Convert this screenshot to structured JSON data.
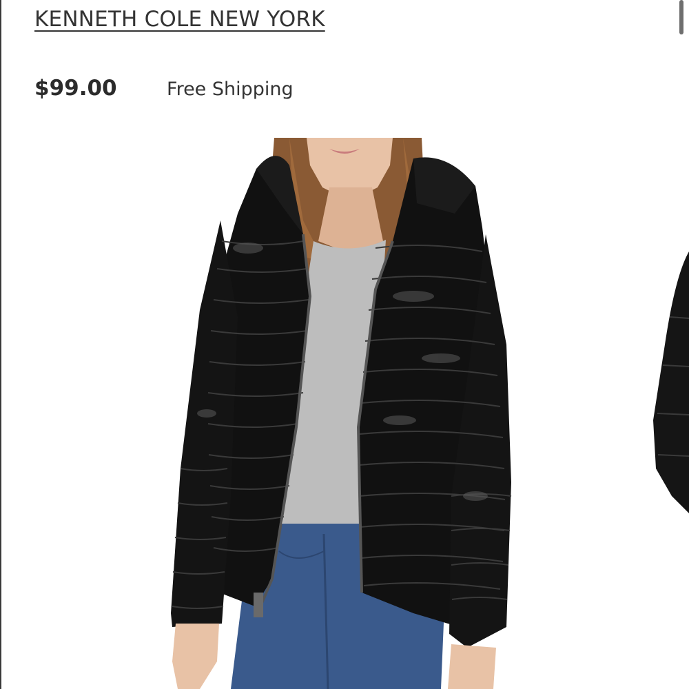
{
  "product": {
    "brand": "KENNETH COLE NEW YORK",
    "price": "$99.00",
    "shipping": "Free Shipping"
  },
  "gallery": {
    "image": "product-photo-black-puffer-jacket",
    "next_preview": "next-product-photo-peek"
  },
  "colors": {
    "text": "#2b2b2b",
    "jacket": "#111111",
    "sweater": "#bdbdbd",
    "jeans": "#3a5a8c",
    "hair": "#8a5a34",
    "skin": "#e8c2a6"
  }
}
